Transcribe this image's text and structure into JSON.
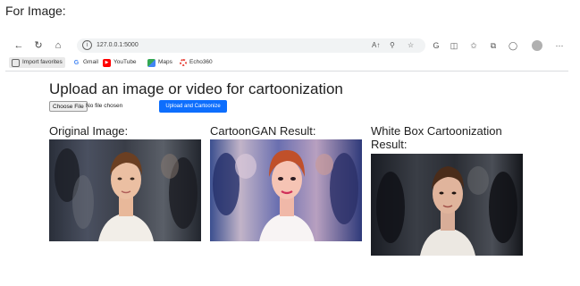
{
  "caption": "For Image:",
  "browser": {
    "url": "127.0.0.1:5000",
    "read_aloud": "A↑",
    "bookmarks": [
      {
        "label": "Import favorites",
        "icon": "import-icon"
      },
      {
        "label": "Gmail",
        "icon": "google-g-icon"
      },
      {
        "label": "YouTube",
        "icon": "youtube-icon"
      },
      {
        "label": "Maps",
        "icon": "maps-icon"
      },
      {
        "label": "Echo360",
        "icon": "echo360-icon"
      }
    ]
  },
  "page": {
    "title": "Upload an image or video for cartoonization",
    "choose_file_label": "Choose File",
    "file_status": "No file chosen",
    "upload_label": "Upload and Cartoonize",
    "accent_color": "#0d6efd"
  },
  "results": [
    {
      "title": "Original Image:"
    },
    {
      "title": "CartoonGAN Result:"
    },
    {
      "title": "White Box Cartoonization Result:"
    }
  ]
}
